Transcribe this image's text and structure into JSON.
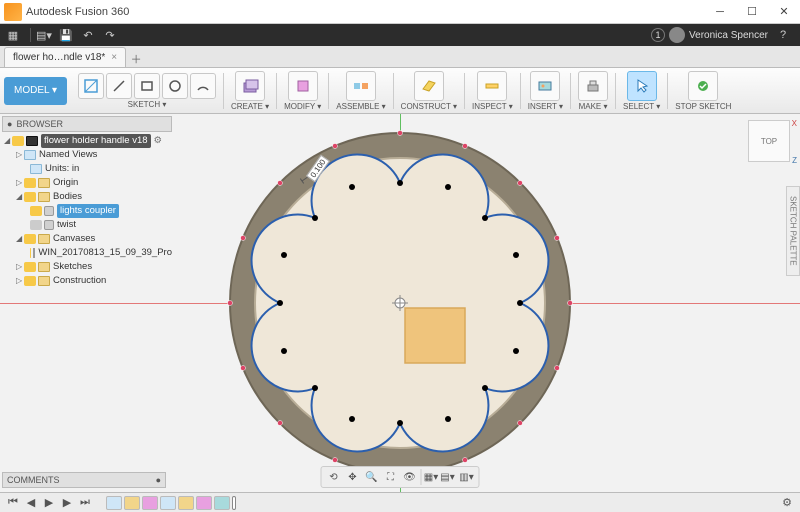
{
  "app": {
    "title": "Autodesk Fusion 360"
  },
  "quick": {
    "notif_count": "1",
    "user": "Veronica Spencer"
  },
  "tab": {
    "label": "flower ho…ndle v18*"
  },
  "ribbon": {
    "model": "MODEL ▾",
    "groups": {
      "sketch": "SKETCH ▾",
      "create": "CREATE ▾",
      "modify": "MODIFY ▾",
      "assemble": "ASSEMBLE ▾",
      "construct": "CONSTRUCT ▾",
      "inspect": "INSPECT ▾",
      "insert": "INSERT ▾",
      "make": "MAKE ▾",
      "select": "SELECT ▾",
      "stop": "STOP SKETCH"
    }
  },
  "browser": {
    "title": "BROWSER",
    "root": "flower holder handle v18",
    "named_views": "Named Views",
    "units": "Units: in",
    "origin": "Origin",
    "bodies": "Bodies",
    "body1": "lights coupler",
    "body2": "twist",
    "canvases": "Canvases",
    "canvas1": "WIN_20170813_15_09_39_Pro",
    "sketches": "Sketches",
    "construction": "Construction"
  },
  "viewcube": {
    "face": "TOP",
    "x": "X",
    "z": "Z"
  },
  "palette": {
    "label": "SKETCH PALETTE"
  },
  "comments": {
    "label": "COMMENTS"
  },
  "sketch": {
    "dim": "0.100"
  }
}
